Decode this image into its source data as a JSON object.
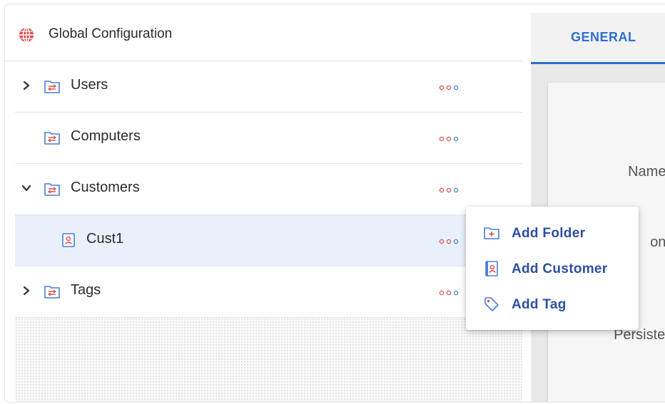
{
  "tree": {
    "header_title": "Global Configuration",
    "items": [
      {
        "label": "Users",
        "expand_state": "collapsed"
      },
      {
        "label": "Computers",
        "expand_state": "none"
      },
      {
        "label": "Customers",
        "expand_state": "expanded"
      },
      {
        "label": "Cust1",
        "expand_state": "none",
        "selected": true
      },
      {
        "label": "Tags",
        "expand_state": "collapsed"
      }
    ]
  },
  "right_panel": {
    "active_tab": "GENERAL",
    "form_labels": [
      "Name:",
      "on:",
      "Persistent"
    ]
  },
  "context_menu": {
    "items": [
      {
        "label": "Add Folder",
        "icon": "add-folder-icon"
      },
      {
        "label": "Add Customer",
        "icon": "customer-icon"
      },
      {
        "label": "Add Tag",
        "icon": "tag-icon"
      }
    ]
  },
  "colors": {
    "accent": "#2f6fd1",
    "menu_text": "#2d4fa3",
    "selected_row": "#e8f0fc",
    "folder_stroke": "#4a7fd8",
    "icon_red": "#d9534f"
  }
}
